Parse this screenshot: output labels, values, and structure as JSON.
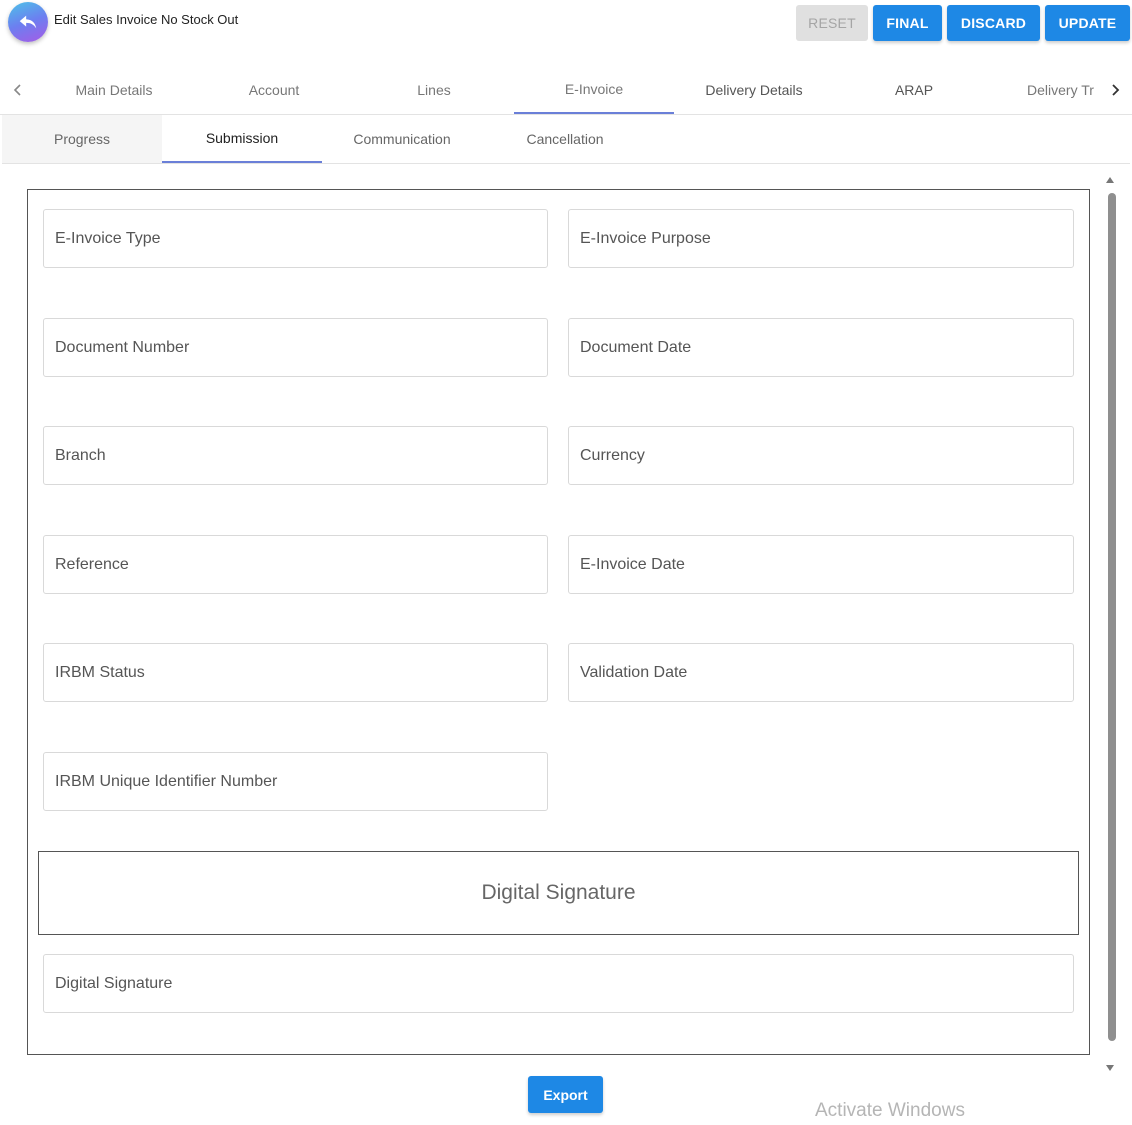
{
  "header": {
    "title": "Edit Sales Invoice No Stock Out",
    "buttons": {
      "reset": "RESET",
      "final": "FINAL",
      "discard": "DISCARD",
      "update": "UPDATE"
    }
  },
  "tabs": [
    "Main Details",
    "Account",
    "Lines",
    "E-Invoice",
    "Delivery Details",
    "ARAP",
    "Delivery Tr"
  ],
  "sub_tabs": [
    "Progress",
    "Submission",
    "Communication",
    "Cancellation"
  ],
  "form": {
    "einvoice_type": "E-Invoice Type",
    "einvoice_purpose": "E-Invoice Purpose",
    "document_number": "Document Number",
    "document_date": "Document Date",
    "branch": "Branch",
    "currency": "Currency",
    "reference": "Reference",
    "einvoice_date": "E-Invoice Date",
    "irbm_status": "IRBM Status",
    "validation_date": "Validation Date",
    "irbm_uin": "IRBM Unique Identifier Number",
    "digital_signature_heading": "Digital Signature",
    "digital_signature": "Digital Signature"
  },
  "export_label": "Export",
  "watermark": "Activate Windows",
  "colors": {
    "primary": "#1e88e5",
    "tab_indicator": "#6a7fd8",
    "disabled": "#e0e0e0"
  }
}
